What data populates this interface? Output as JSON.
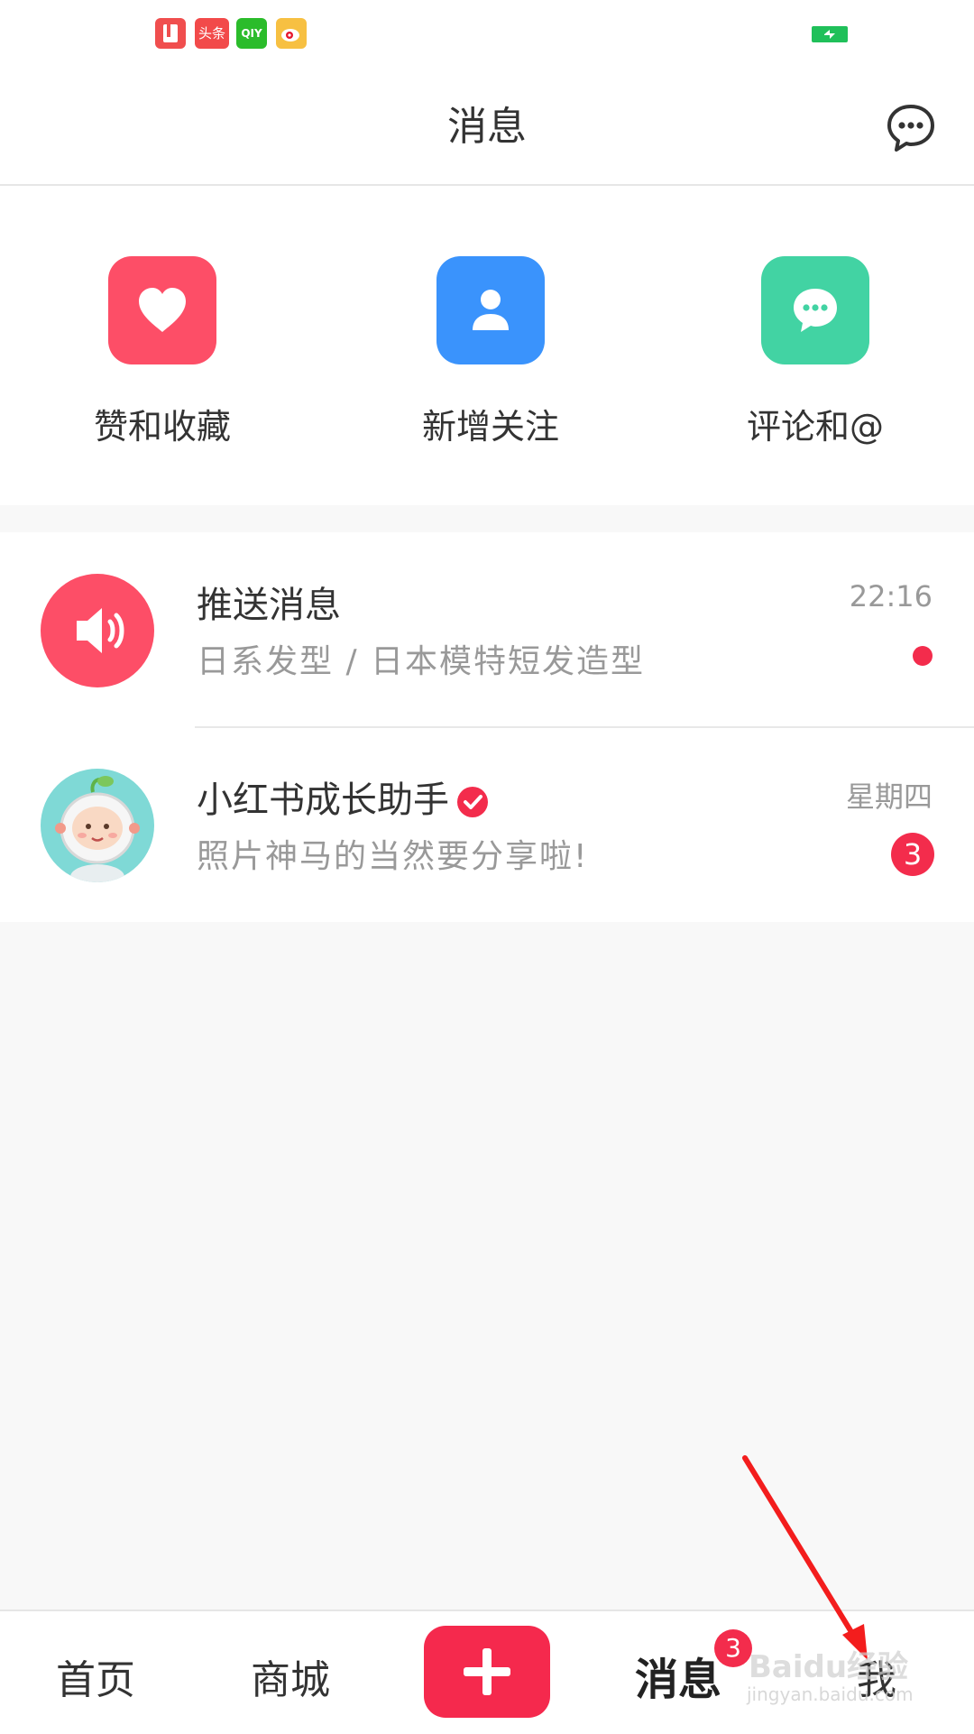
{
  "status_bar": {
    "icons": [
      "book-app-icon",
      "toutiao-icon",
      "iqiyi-icon",
      "weibo-icon"
    ],
    "toutiao_text": "头条",
    "iqiyi_text": "QIY"
  },
  "header": {
    "title": "消息"
  },
  "quick_actions": [
    {
      "label": "赞和收藏",
      "icon": "heart-icon",
      "color": "#fd4e67"
    },
    {
      "label": "新增关注",
      "icon": "user-icon",
      "color": "#3a93fc"
    },
    {
      "label": "评论和@",
      "icon": "comment-icon",
      "color": "#42d3a3"
    }
  ],
  "messages": [
    {
      "title": "推送消息",
      "subtitle": "日系发型 / 日本模特短发造型",
      "time": "22:16",
      "unread": "dot"
    },
    {
      "title": "小红书成长助手",
      "subtitle": "照片神马的当然要分享啦!",
      "time": "星期四",
      "unread_count": "3",
      "verified": true
    }
  ],
  "bottom_nav": {
    "home": "首页",
    "mall": "商城",
    "messages": "消息",
    "messages_badge": "3",
    "me": "我"
  },
  "watermark": {
    "main": "Baidu经验",
    "sub": "jingyan.baidu.com"
  },
  "colors": {
    "accent": "#f32c4c",
    "plus": "#f5294d"
  }
}
